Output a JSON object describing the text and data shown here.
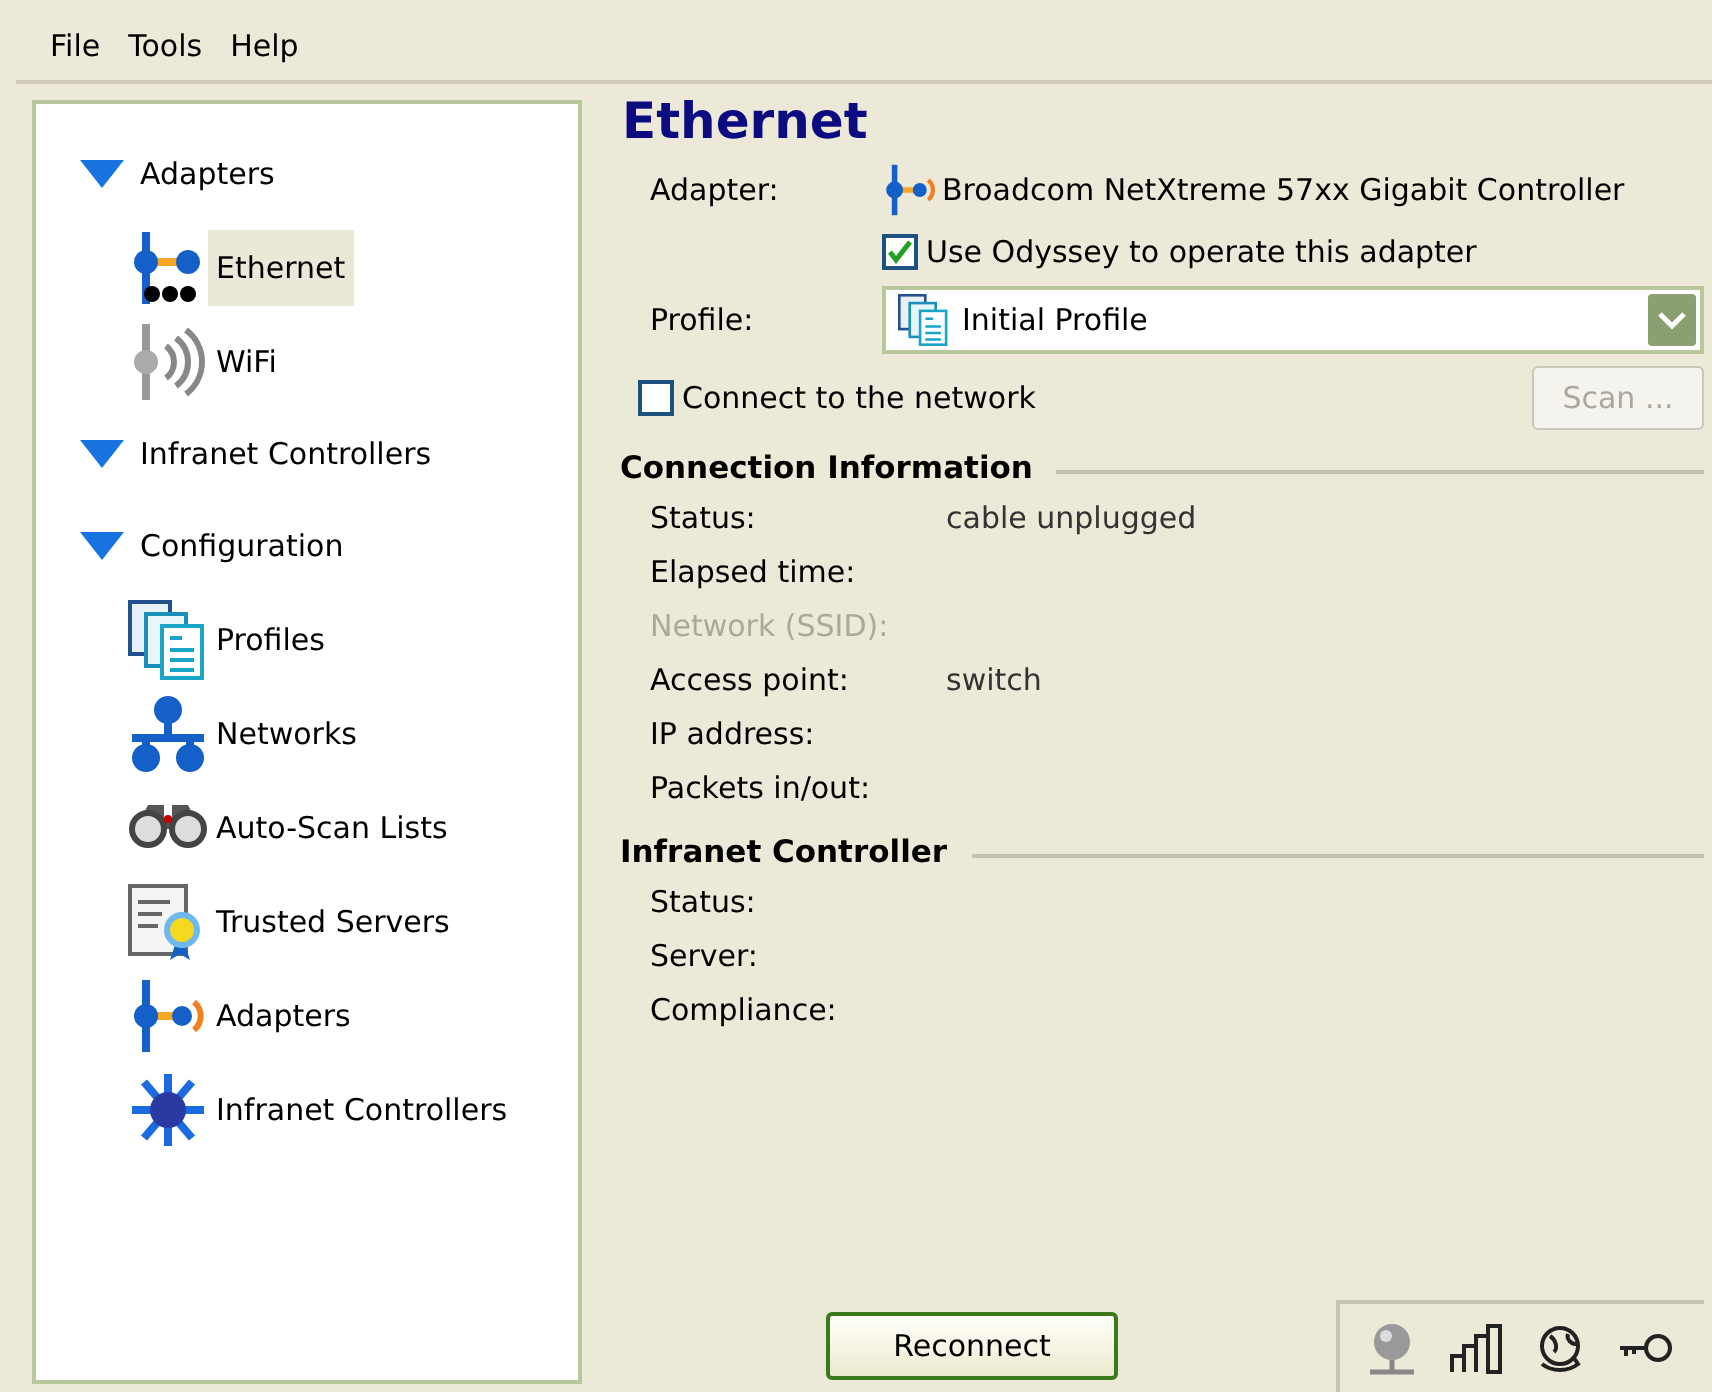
{
  "menu": [
    {
      "label": "File"
    },
    {
      "label": "Tools"
    },
    {
      "label": "Help"
    }
  ],
  "sidebar": {
    "groups": [
      {
        "label": "Adapters",
        "expanded": true,
        "children": [
          {
            "label": "Ethernet",
            "kind": "ethernet",
            "selected": true
          },
          {
            "label": "WiFi",
            "kind": "wifi",
            "selected": false
          }
        ]
      },
      {
        "label": "Infranet Controllers",
        "expanded": true
      },
      {
        "label": "Configuration",
        "expanded": true,
        "children": [
          {
            "label": "Profiles",
            "kind": "profiles",
            "selected": false
          },
          {
            "label": "Networks",
            "kind": "networks",
            "selected": false
          },
          {
            "label": "Auto-Scan Lists",
            "kind": "binoculars",
            "selected": false
          },
          {
            "label": "Trusted Servers",
            "kind": "certificate",
            "selected": false
          },
          {
            "label": "Adapters",
            "kind": "adapter",
            "selected": false
          },
          {
            "label": "Infranet Controllers",
            "kind": "controller",
            "selected": false
          }
        ]
      }
    ]
  },
  "panel": {
    "title": "Ethernet",
    "adapter": {
      "label": "Adapter:",
      "value": "Broadcom NetXtreme 57xx Gigabit Controller"
    },
    "use_odyssey": {
      "label": "Use Odyssey to operate this adapter",
      "checked": true
    },
    "profile": {
      "label": "Profile:",
      "value": "Initial Profile"
    },
    "connect": {
      "label": "Connect to the network",
      "checked": false
    },
    "scan_button": {
      "label": "Scan ...",
      "disabled": true
    },
    "sections": [
      {
        "title": "Connection Information",
        "rows": [
          {
            "label": "Status:",
            "value": "cable unplugged",
            "disabled": false
          },
          {
            "label": "Elapsed time:",
            "disabled": false
          },
          {
            "label": "Network (SSID):",
            "disabled": true
          },
          {
            "label": "Access point:",
            "value": "switch",
            "disabled": false
          },
          {
            "label": "IP address:",
            "disabled": false
          },
          {
            "label": "Packets in/out:",
            "disabled": false
          }
        ]
      },
      {
        "title": "Infranet Controller",
        "rows": [
          {
            "label": "Status:",
            "disabled": false
          },
          {
            "label": "Server:",
            "disabled": false
          },
          {
            "label": "Compliance:",
            "disabled": false
          }
        ]
      }
    ],
    "reconnect_button": {
      "label": "Reconnect"
    }
  }
}
